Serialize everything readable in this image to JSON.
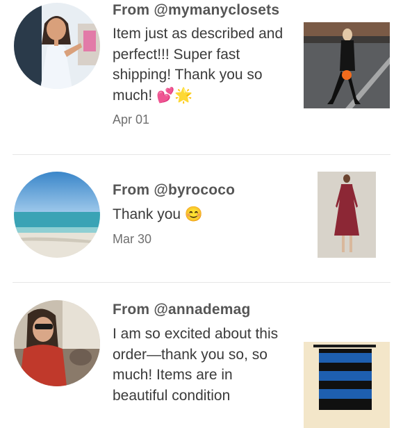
{
  "reviews": [
    {
      "from": "From @mymanyclosets",
      "message": "Item just as described and perfect!!! Super fast shipping! Thank you so much! 💕🌟",
      "date": "Apr 01",
      "avatar_icon": "cartoon-woman-avatar",
      "thumb_icon": "woman-black-outfit-orange-bag-photo"
    },
    {
      "from": "From @byrococo",
      "message": "Thank you 😊",
      "date": "Mar 30",
      "avatar_icon": "beach-ocean-avatar",
      "thumb_icon": "burgundy-dress-photo"
    },
    {
      "from": "From @annademag",
      "message": "I am so excited about this order—thank you so, so much! Items are in beautiful condition",
      "avatar_icon": "woman-car-avatar",
      "thumb_icon": "blue-black-striped-skirt-photo"
    }
  ]
}
